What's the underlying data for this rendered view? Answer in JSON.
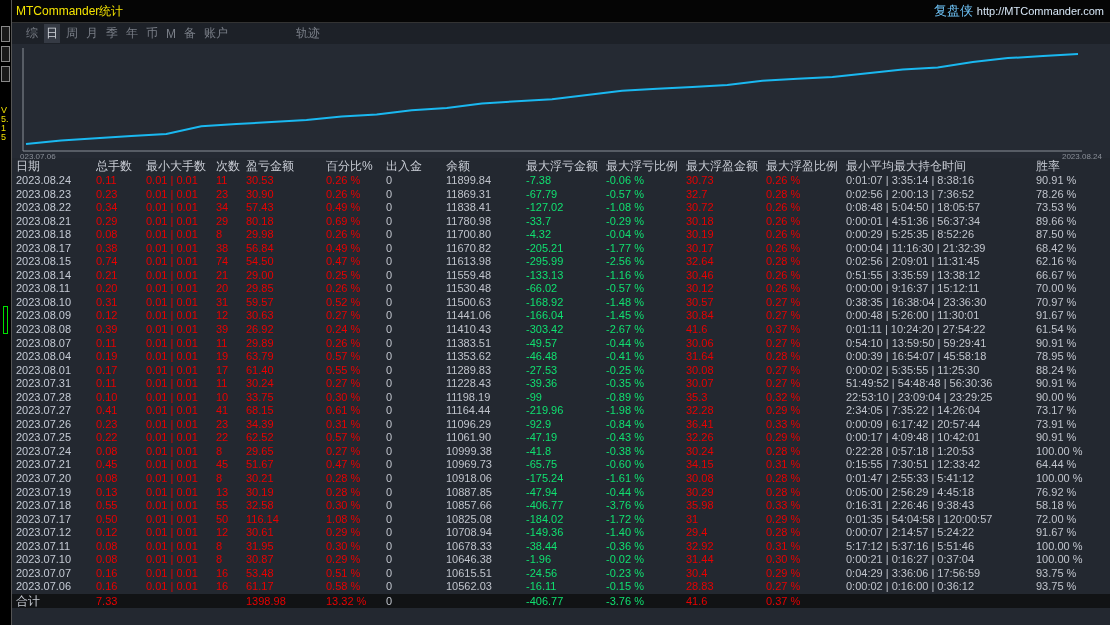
{
  "window": {
    "title": "MTCommander统计",
    "brand": "复盘侠",
    "url": "http://MTCommander.com"
  },
  "side": {
    "version": "V5.15"
  },
  "tabs": [
    {
      "label": "综",
      "selected": false
    },
    {
      "label": "日",
      "selected": true
    },
    {
      "label": "周",
      "selected": false
    },
    {
      "label": "月",
      "selected": false
    },
    {
      "label": "季",
      "selected": false
    },
    {
      "label": "年",
      "selected": false
    },
    {
      "label": "币",
      "selected": false
    },
    {
      "label": "M",
      "selected": false
    },
    {
      "label": "备",
      "selected": false
    },
    {
      "label": "账户",
      "selected": false
    }
  ],
  "extra_tabs": [
    {
      "label": "轨迹",
      "selected": false
    }
  ],
  "chart": {
    "start_label": "023.07.06",
    "end_label": "2023.08.24"
  },
  "table": {
    "columns": [
      "日期",
      "总手数",
      "最小大手数",
      "次数",
      "盈亏金额",
      "百分比%",
      "出入金",
      "余额",
      "最大浮亏金额",
      "最大浮亏比例",
      "最大浮盈金额",
      "最大浮盈比例",
      "最小平均最大持仓时间",
      "胜率"
    ],
    "rows": [
      [
        "2023.08.24",
        "0.11",
        "0.01 | 0.01",
        "11",
        "30.53",
        "0.26 %",
        "0",
        "11899.84",
        "-7.38",
        "-0.06 %",
        "30.73",
        "0.26 %",
        "0:01:07 | 3:35:14 | 8:38:16",
        "90.91 %"
      ],
      [
        "2023.08.23",
        "0.23",
        "0.01 | 0.01",
        "23",
        "30.90",
        "0.26 %",
        "0",
        "11869.31",
        "-67.79",
        "-0.57 %",
        "32.7",
        "0.28 %",
        "0:02:56 | 2:00:13 | 7:36:52",
        "78.26 %"
      ],
      [
        "2023.08.22",
        "0.34",
        "0.01 | 0.01",
        "34",
        "57.43",
        "0.49 %",
        "0",
        "11838.41",
        "-127.02",
        "-1.08 %",
        "30.72",
        "0.26 %",
        "0:08:48 | 5:04:50 | 18:05:57",
        "73.53 %"
      ],
      [
        "2023.08.21",
        "0.29",
        "0.01 | 0.01",
        "29",
        "80.18",
        "0.69 %",
        "0",
        "11780.98",
        "-33.7",
        "-0.29 %",
        "30.18",
        "0.26 %",
        "0:00:01 | 4:51:36 | 56:37:34",
        "89.66 %"
      ],
      [
        "2023.08.18",
        "0.08",
        "0.01 | 0.01",
        "8",
        "29.98",
        "0.26 %",
        "0",
        "11700.80",
        "-4.32",
        "-0.04 %",
        "30.19",
        "0.26 %",
        "0:00:29 | 5:25:35 | 8:52:26",
        "87.50 %"
      ],
      [
        "2023.08.17",
        "0.38",
        "0.01 | 0.01",
        "38",
        "56.84",
        "0.49 %",
        "0",
        "11670.82",
        "-205.21",
        "-1.77 %",
        "30.17",
        "0.26 %",
        "0:00:04 | 11:16:30 | 21:32:39",
        "68.42 %"
      ],
      [
        "2023.08.15",
        "0.74",
        "0.01 | 0.01",
        "74",
        "54.50",
        "0.47 %",
        "0",
        "11613.98",
        "-295.99",
        "-2.56 %",
        "32.64",
        "0.28 %",
        "0:02:56 | 2:09:01 | 11:31:45",
        "62.16 %"
      ],
      [
        "2023.08.14",
        "0.21",
        "0.01 | 0.01",
        "21",
        "29.00",
        "0.25 %",
        "0",
        "11559.48",
        "-133.13",
        "-1.16 %",
        "30.46",
        "0.26 %",
        "0:51:55 | 3:35:59 | 13:38:12",
        "66.67 %"
      ],
      [
        "2023.08.11",
        "0.20",
        "0.01 | 0.01",
        "20",
        "29.85",
        "0.26 %",
        "0",
        "11530.48",
        "-66.02",
        "-0.57 %",
        "30.12",
        "0.26 %",
        "0:00:00 | 9:16:37 | 15:12:11",
        "70.00 %"
      ],
      [
        "2023.08.10",
        "0.31",
        "0.01 | 0.01",
        "31",
        "59.57",
        "0.52 %",
        "0",
        "11500.63",
        "-168.92",
        "-1.48 %",
        "30.57",
        "0.27 %",
        "0:38:35 | 16:38:04 | 23:36:30",
        "70.97 %"
      ],
      [
        "2023.08.09",
        "0.12",
        "0.01 | 0.01",
        "12",
        "30.63",
        "0.27 %",
        "0",
        "11441.06",
        "-166.04",
        "-1.45 %",
        "30.84",
        "0.27 %",
        "0:00:48 | 5:26:00 | 11:30:01",
        "91.67 %"
      ],
      [
        "2023.08.08",
        "0.39",
        "0.01 | 0.01",
        "39",
        "26.92",
        "0.24 %",
        "0",
        "11410.43",
        "-303.42",
        "-2.67 %",
        "41.6",
        "0.37 %",
        "0:01:11 | 10:24:20 | 27:54:22",
        "61.54 %"
      ],
      [
        "2023.08.07",
        "0.11",
        "0.01 | 0.01",
        "11",
        "29.89",
        "0.26 %",
        "0",
        "11383.51",
        "-49.57",
        "-0.44 %",
        "30.06",
        "0.27 %",
        "0:54:10 | 13:59:50 | 59:29:41",
        "90.91 %"
      ],
      [
        "2023.08.04",
        "0.19",
        "0.01 | 0.01",
        "19",
        "63.79",
        "0.57 %",
        "0",
        "11353.62",
        "-46.48",
        "-0.41 %",
        "31.64",
        "0.28 %",
        "0:00:39 | 16:54:07 | 45:58:18",
        "78.95 %"
      ],
      [
        "2023.08.01",
        "0.17",
        "0.01 | 0.01",
        "17",
        "61.40",
        "0.55 %",
        "0",
        "11289.83",
        "-27.53",
        "-0.25 %",
        "30.08",
        "0.27 %",
        "0:00:02 | 5:35:55 | 11:25:30",
        "88.24 %"
      ],
      [
        "2023.07.31",
        "0.11",
        "0.01 | 0.01",
        "11",
        "30.24",
        "0.27 %",
        "0",
        "11228.43",
        "-39.36",
        "-0.35 %",
        "30.07",
        "0.27 %",
        "51:49:52 | 54:48:48 | 56:30:36",
        "90.91 %"
      ],
      [
        "2023.07.28",
        "0.10",
        "0.01 | 0.01",
        "10",
        "33.75",
        "0.30 %",
        "0",
        "11198.19",
        "-99",
        "-0.89 %",
        "35.3",
        "0.32 %",
        "22:53:10 | 23:09:04 | 23:29:25",
        "90.00 %"
      ],
      [
        "2023.07.27",
        "0.41",
        "0.01 | 0.01",
        "41",
        "68.15",
        "0.61 %",
        "0",
        "11164.44",
        "-219.96",
        "-1.98 %",
        "32.28",
        "0.29 %",
        "2:34:05 | 7:35:22 | 14:26:04",
        "73.17 %"
      ],
      [
        "2023.07.26",
        "0.23",
        "0.01 | 0.01",
        "23",
        "34.39",
        "0.31 %",
        "0",
        "11096.29",
        "-92.9",
        "-0.84 %",
        "36.41",
        "0.33 %",
        "0:00:09 | 6:17:42 | 20:57:44",
        "73.91 %"
      ],
      [
        "2023.07.25",
        "0.22",
        "0.01 | 0.01",
        "22",
        "62.52",
        "0.57 %",
        "0",
        "11061.90",
        "-47.19",
        "-0.43 %",
        "32.26",
        "0.29 %",
        "0:00:17 | 4:09:48 | 10:42:01",
        "90.91 %"
      ],
      [
        "2023.07.24",
        "0.08",
        "0.01 | 0.01",
        "8",
        "29.65",
        "0.27 %",
        "0",
        "10999.38",
        "-41.8",
        "-0.38 %",
        "30.24",
        "0.28 %",
        "0:22:28 | 0:57:18 | 1:20:53",
        "100.00 %"
      ],
      [
        "2023.07.21",
        "0.45",
        "0.01 | 0.01",
        "45",
        "51.67",
        "0.47 %",
        "0",
        "10969.73",
        "-65.75",
        "-0.60 %",
        "34.15",
        "0.31 %",
        "0:15:55 | 7:30:51 | 12:33:42",
        "64.44 %"
      ],
      [
        "2023.07.20",
        "0.08",
        "0.01 | 0.01",
        "8",
        "30.21",
        "0.28 %",
        "0",
        "10918.06",
        "-175.24",
        "-1.61 %",
        "30.08",
        "0.28 %",
        "0:01:47 | 2:55:33 | 5:41:12",
        "100.00 %"
      ],
      [
        "2023.07.19",
        "0.13",
        "0.01 | 0.01",
        "13",
        "30.19",
        "0.28 %",
        "0",
        "10887.85",
        "-47.94",
        "-0.44 %",
        "30.29",
        "0.28 %",
        "0:05:00 | 2:56:29 | 4:45:18",
        "76.92 %"
      ],
      [
        "2023.07.18",
        "0.55",
        "0.01 | 0.01",
        "55",
        "32.58",
        "0.30 %",
        "0",
        "10857.66",
        "-406.77",
        "-3.76 %",
        "35.98",
        "0.33 %",
        "0:16:31 | 2:26:46 | 9:38:43",
        "58.18 %"
      ],
      [
        "2023.07.17",
        "0.50",
        "0.01 | 0.01",
        "50",
        "116.14",
        "1.08 %",
        "0",
        "10825.08",
        "-184.02",
        "-1.72 %",
        "31",
        "0.29 %",
        "0:01:35 | 54:04:58 | 120:00:57",
        "72.00 %"
      ],
      [
        "2023.07.12",
        "0.12",
        "0.01 | 0.01",
        "12",
        "30.61",
        "0.29 %",
        "0",
        "10708.94",
        "-149.36",
        "-1.40 %",
        "29.4",
        "0.28 %",
        "0:00:07 | 2:14:57 | 5:24:22",
        "91.67 %"
      ],
      [
        "2023.07.11",
        "0.08",
        "0.01 | 0.01",
        "8",
        "31.95",
        "0.30 %",
        "0",
        "10678.33",
        "-38.44",
        "-0.36 %",
        "32.92",
        "0.31 %",
        "5:17:12 | 5:37:16 | 5:51:46",
        "100.00 %"
      ],
      [
        "2023.07.10",
        "0.08",
        "0.01 | 0.01",
        "8",
        "30.87",
        "0.29 %",
        "0",
        "10646.38",
        "-1.96",
        "-0.02 %",
        "31.44",
        "0.30 %",
        "0:00:21 | 0:16:27 | 0:37:04",
        "100.00 %"
      ],
      [
        "2023.07.07",
        "0.16",
        "0.01 | 0.01",
        "16",
        "53.48",
        "0.51 %",
        "0",
        "10615.51",
        "-24.56",
        "-0.23 %",
        "30.4",
        "0.29 %",
        "0:04:29 | 3:36:06 | 17:56:59",
        "93.75 %"
      ],
      [
        "2023.07.06",
        "0.16",
        "0.01 | 0.01",
        "16",
        "61.17",
        "0.58 %",
        "0",
        "10562.03",
        "-16.11",
        "-0.15 %",
        "28.83",
        "0.27 %",
        "0:00:02 | 0:16:00 | 0:36:12",
        "93.75 %"
      ]
    ],
    "total": {
      "label": "合计",
      "lots": "7.33",
      "profit": "1398.98",
      "percent": "13.32 %",
      "deposit": "0",
      "max_float_loss": "-406.77",
      "max_float_loss_pct": "-3.76 %",
      "max_float_profit": "41.6",
      "max_float_profit_pct": "0.37 %"
    }
  }
}
